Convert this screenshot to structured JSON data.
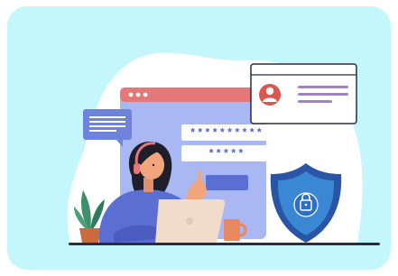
{
  "illustration": {
    "scene": "secure-login",
    "colors": {
      "card_bg": "#c4f7fb",
      "backdrop_blob": "#ffffff",
      "window_body": "#a9b8f3",
      "window_titlebar": "#e47777",
      "field": "#ffffff",
      "field_text": "#4f62c8",
      "button": "#5b6fd3",
      "profile_avatar": "#d9574f",
      "profile_lines": "#a77ad8",
      "chat_bubble": "#6e83dc",
      "shield_outer": "#2a55a6",
      "shield_inner": "#3a87d4",
      "person_shirt": "#5b6fd3",
      "hair": "#1e1f2b",
      "skin": "#f0a57d",
      "laptop": "#f1dccc",
      "mug": "#e9885e",
      "plant": "#3f8e6c",
      "pot": "#c96a3f",
      "ground": "#2b2d3e"
    },
    "password_field": "**********",
    "pin_field": "*****"
  }
}
